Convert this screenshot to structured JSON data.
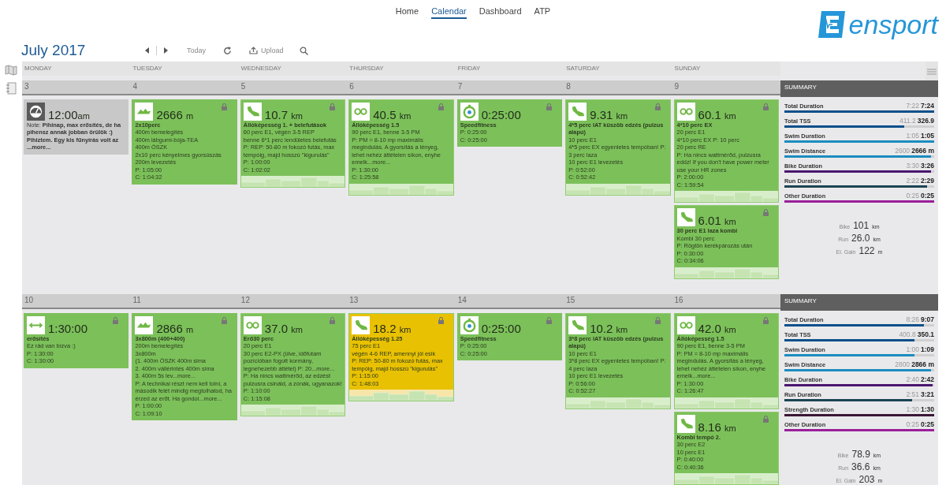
{
  "nav": [
    {
      "label": "Home",
      "selected": false
    },
    {
      "label": "Calendar",
      "selected": true
    },
    {
      "label": "Dashboard",
      "selected": false
    },
    {
      "label": "ATP",
      "selected": false
    }
  ],
  "logo": "ensport",
  "toolbar": {
    "month": "July",
    "year": "2017",
    "today": "Today",
    "upload": "Upload"
  },
  "weekdays": [
    "MONDAY",
    "TUESDAY",
    "WEDNESDAY",
    "THURSDAY",
    "FRIDAY",
    "SATURDAY",
    "SUNDAY"
  ],
  "weeks": [
    {
      "days": [
        {
          "date": "3",
          "workouts": [
            {
              "kind": "note",
              "value": "12:00",
              "unit": "am",
              "text": "Note: **Pihinap, max erősítés, de ha pihensz annak jobban örülök :) Pihiztem. Egy kis fűnyírás volt az ...more...**"
            }
          ]
        },
        {
          "date": "4",
          "workouts": [
            {
              "kind": "swim",
              "color": "#7cc05a",
              "locked": true,
              "value": "2666",
              "unit": "m",
              "title": "2x10perc",
              "lines": [
                "400m bemelegítés",
                "400m lábgumi-bója-TEA",
                "400m ÖSZK",
                "2x10 perc kényelmes gyorsúszás",
                "200m levezetés",
                "P: 1:05:00",
                "C: 1:04:32"
              ]
            }
          ]
        },
        {
          "date": "5",
          "workouts": [
            {
              "kind": "run",
              "color": "#7cc05a",
              "locked": true,
              "value": "10.7",
              "unit": "km",
              "title": "Állóképesség 1. + belefutások",
              "lines": [
                "60 perc E1, végén 3-5 REP",
                "benne 6*1 perc lendületes belefutás",
                "P: REP: 50-80 m fokozó futás, max tempóig, majd hosszú \"kigurulás\"",
                "P: 1:00:00",
                "C: 1:02:02"
              ],
              "graph": true
            }
          ]
        },
        {
          "date": "6",
          "workouts": [
            {
              "kind": "bike",
              "color": "#7cc05a",
              "locked": true,
              "value": "40.5",
              "unit": "km",
              "title": "Állóképesség 1.5",
              "lines": [
                "90 perc E1, benne 3-5 PM",
                "P: PM = 8-10 mp maximális megindulás. A gyorsítás a lényeg, lehet nehéz áttételen síkon, enyhe emelk...more...",
                "P: 1:30:00",
                "C: 1:25:58"
              ],
              "graph": true
            }
          ]
        },
        {
          "date": "7",
          "workouts": [
            {
              "kind": "other",
              "color": "#7cc05a",
              "locked": true,
              "value": "0:25:00",
              "title": "Speedfitness",
              "lines": [
                "P: 0:25:00",
                "C: 0:25:00"
              ]
            }
          ]
        },
        {
          "date": "8",
          "workouts": [
            {
              "kind": "run",
              "color": "#7cc05a",
              "locked": true,
              "value": "9.31",
              "unit": "km",
              "title": "4*5 perc IAT küszöb edzés (pulzus alapú)",
              "lines": [
                "10 perc E1",
                "4*5 perc EX egyenletes tempóban! P: 3 perc laza",
                "10 perc E1 levezetés",
                "P: 0:52:00",
                "C: 0:52:42"
              ],
              "graph": true
            }
          ]
        },
        {
          "date": "9",
          "workouts": [
            {
              "kind": "bike",
              "color": "#7cc05a",
              "locked": true,
              "value": "60.1",
              "unit": "km",
              "title": "4*10 perc EX",
              "lines": [
                "20 perc E1",
                "4*10 perc EX P: 10 perc",
                "20 perc RE",
                "P: Ha nincs wattmérőd, pulzusra eddz! If you don't have power meter use your HR zones",
                "P: 2:00:00",
                "C: 1:59:54"
              ],
              "graph": true
            },
            {
              "kind": "run",
              "color": "#7cc05a",
              "locked": true,
              "value": "6.01",
              "unit": "km",
              "title": "30 perc E1 laza kombi",
              "lines": [
                "Kombi 30 perc",
                "P: Rögtön kerékpározás után",
                "P: 0:30:00",
                "C: 0:34:06"
              ],
              "graph": true
            }
          ]
        }
      ],
      "summary": {
        "title": "SUMMARY",
        "rows": [
          {
            "label": "Total Duration",
            "planned": "7:22",
            "actual": "7:24",
            "level": 1,
            "color": "#0b4f8a"
          },
          {
            "label": "Total TSS",
            "planned": "411.2",
            "actual": "326.9",
            "level": 0.8,
            "color": "#0b4f8a"
          },
          {
            "label": "Swim Duration",
            "planned": "1:05",
            "actual": "1:05",
            "level": 1,
            "color": "#1c8cc0"
          },
          {
            "label": "Swim Distance",
            "planned": "2600",
            "actual": "2666 m",
            "level": 0.98,
            "color": "#1c8cc0"
          },
          {
            "label": "Bike Duration",
            "planned": "3:30",
            "actual": "3:26",
            "level": 0.98,
            "color": "#4a1670"
          },
          {
            "label": "Run Duration",
            "planned": "2:22",
            "actual": "2:29",
            "level": 0.95,
            "color": "#1b4454"
          },
          {
            "label": "Other Duration",
            "planned": "0:25",
            "actual": "0:25",
            "level": 1,
            "color": "#9a1f9a"
          }
        ],
        "totals": [
          {
            "label": "Bike",
            "value": "101",
            "unit": "km"
          },
          {
            "label": "Run",
            "value": "26.0",
            "unit": "km"
          },
          {
            "label": "El. Gain",
            "value": "122",
            "unit": "m"
          }
        ]
      }
    },
    {
      "days": [
        {
          "date": "10",
          "workouts": [
            {
              "kind": "strength",
              "color": "#7cc05a",
              "locked": true,
              "value": "1:30:00",
              "title": "erősítés",
              "lines": [
                "Ez rád van bízva :)",
                "P: 1:30:00",
                "C: 1:30:00"
              ]
            }
          ]
        },
        {
          "date": "11",
          "workouts": [
            {
              "kind": "swim",
              "color": "#7cc05a",
              "locked": true,
              "value": "2866",
              "unit": "m",
              "title": "3x800m (400+400)",
              "lines": [
                "200m bemelegítés",
                "3x800m",
                "(1. 400m ÖSZK 400m sima",
                "2. 400m vállérintés 400m sima",
                "3. 400m 5s lev...more...",
                "P: A technikai részt nem kell tolni, a második felét mindig megtolhatod, ha érzed az erőt. Ha gondol...more...",
                "P: 1:00:00",
                "C: 1:09:10"
              ]
            }
          ]
        },
        {
          "date": "12",
          "workouts": [
            {
              "kind": "bike",
              "color": "#7cc05a",
              "locked": true,
              "value": "37.0",
              "unit": "km",
              "title": "Erő30 perc",
              "lines": [
                "20 perc E1",
                "30 perc E2-PX (ülve, időfutam pozícióban fogott kormány, legnehezebb áttétel) P: 20...more...",
                "P: Ha nincs wattmérőd, az edzést pulzusra csináld, a zónák, ugyanazok!",
                "P: 1:10:00",
                "C: 1:15:08"
              ],
              "graph": true
            }
          ]
        },
        {
          "date": "13",
          "workouts": [
            {
              "kind": "run",
              "color": "#e9c103",
              "locked": true,
              "value": "18.2",
              "unit": "km",
              "title": "Állóképesség 1.25",
              "lines": [
                "75 perc E1",
                "végén 4-6 REP, amennyi jól esik",
                "P: REP: 50-80 m fokozó futás, max tempóig, majd hosszú \"kigurulás\"",
                "P: 1:15:00",
                "C: 1:48:03"
              ],
              "graph": true
            }
          ]
        },
        {
          "date": "14",
          "workouts": [
            {
              "kind": "other",
              "color": "#7cc05a",
              "locked": true,
              "value": "0:25:00",
              "title": "Speedfitness",
              "lines": [
                "P: 0:25:00",
                "C: 0:25:00"
              ]
            }
          ]
        },
        {
          "date": "15",
          "workouts": [
            {
              "kind": "run",
              "color": "#7cc05a",
              "locked": true,
              "value": "10.2",
              "unit": "km",
              "title": "3*8 perc IAT küszöb edzés (pulzus alapú)",
              "lines": [
                "10 perc E1",
                "3*8 perc EX egyenletes tempóban! P: 4 perc laza",
                "10 perc E1 levezetés",
                "P: 0:56:00",
                "C: 0:52:27"
              ],
              "graph": true
            }
          ]
        },
        {
          "date": "16",
          "workouts": [
            {
              "kind": "bike",
              "color": "#7cc05a",
              "locked": true,
              "value": "42.0",
              "unit": "km",
              "title": "Állóképesség 1.5",
              "lines": [
                "90 perc E1, benne 3-5 PM",
                "P: PM = 8-10 mp maximális megindulás. A gyorsítás a lényeg, lehet nehéz áttételen síkon, enyhe emelk...more...",
                "P: 1:30:00",
                "C: 1:26:47"
              ],
              "graph": true
            },
            {
              "kind": "run",
              "color": "#7cc05a",
              "locked": true,
              "value": "8.16",
              "unit": "km",
              "title": "Kombi tempó 2.",
              "lines": [
                "30 perc E2",
                "10 perc E1",
                "P: 0:40:00",
                "C: 0:40:36"
              ],
              "graph": true
            }
          ]
        }
      ],
      "summary": {
        "title": "SUMMARY",
        "rows": [
          {
            "label": "Total Duration",
            "planned": "8:26",
            "actual": "9:07",
            "level": 0.93,
            "color": "#0b4f8a"
          },
          {
            "label": "Total TSS",
            "planned": "400.8",
            "actual": "350.1",
            "level": 0.87,
            "color": "#0b4f8a"
          },
          {
            "label": "Swim Duration",
            "planned": "1:00",
            "actual": "1:09",
            "level": 0.87,
            "color": "#1c8cc0"
          },
          {
            "label": "Swim Distance",
            "planned": "2800",
            "actual": "2866 m",
            "level": 0.98,
            "color": "#1c8cc0"
          },
          {
            "label": "Bike Duration",
            "planned": "2:40",
            "actual": "2:42",
            "level": 0.99,
            "color": "#4a1670"
          },
          {
            "label": "Run Duration",
            "planned": "2:51",
            "actual": "3:21",
            "level": 0.85,
            "color": "#1b4454"
          },
          {
            "label": "Strength Duration",
            "planned": "1:30",
            "actual": "1:30",
            "level": 1,
            "color": "#3a1636"
          },
          {
            "label": "Other Duration",
            "planned": "0:25",
            "actual": "0:25",
            "level": 1,
            "color": "#9a1f9a"
          }
        ],
        "totals": [
          {
            "label": "Bike",
            "value": "78.9",
            "unit": "km"
          },
          {
            "label": "Run",
            "value": "36.6",
            "unit": "km"
          },
          {
            "label": "El. Gain",
            "value": "203",
            "unit": "m"
          }
        ]
      }
    }
  ]
}
